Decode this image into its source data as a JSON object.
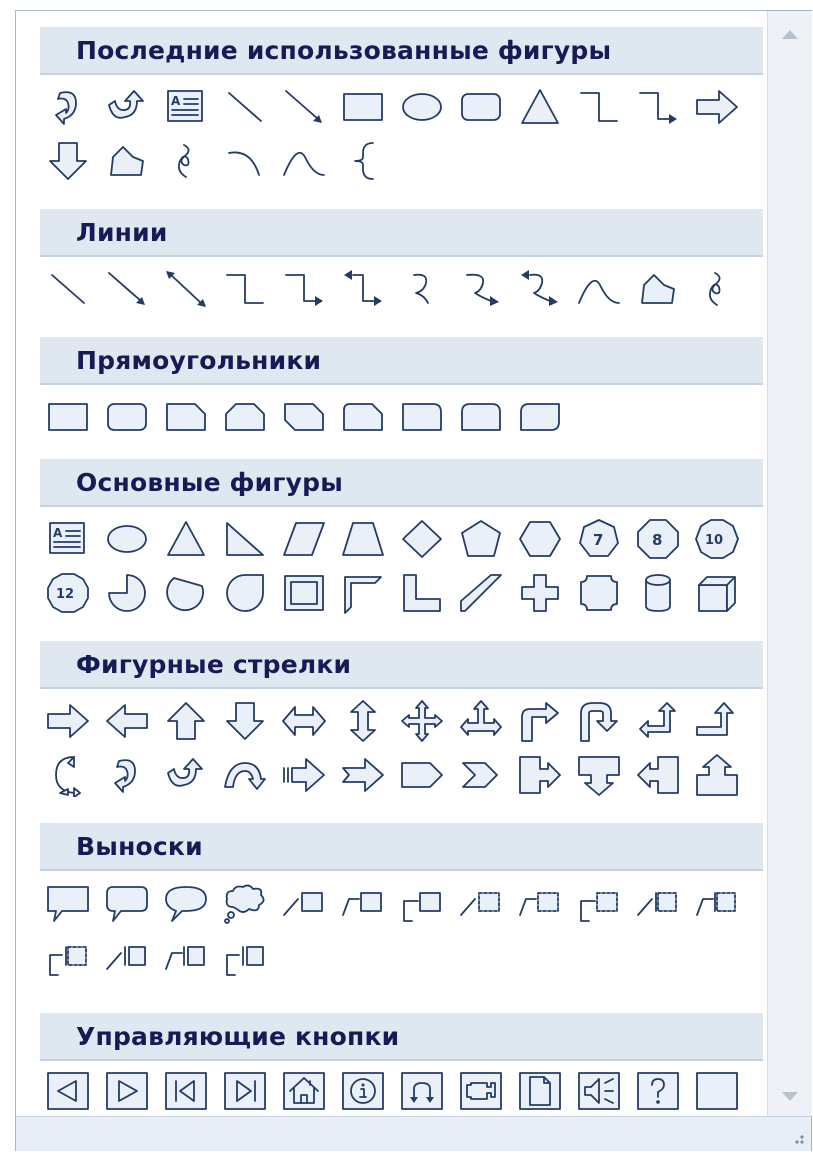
{
  "gallery": {
    "categories": [
      {
        "title": "Последние использованные фигуры"
      },
      {
        "title": "Линии"
      },
      {
        "title": "Прямоугольники"
      },
      {
        "title": "Основные фигуры"
      },
      {
        "title": "Фигурные стрелки"
      },
      {
        "title": "Выноски"
      },
      {
        "title": "Управляющие кнопки"
      }
    ]
  },
  "colors": {
    "header_bg": "#dfe7f1",
    "header_text": "#151c55",
    "icon_stroke": "#243c65",
    "icon_fill": "#e9f0f8"
  }
}
